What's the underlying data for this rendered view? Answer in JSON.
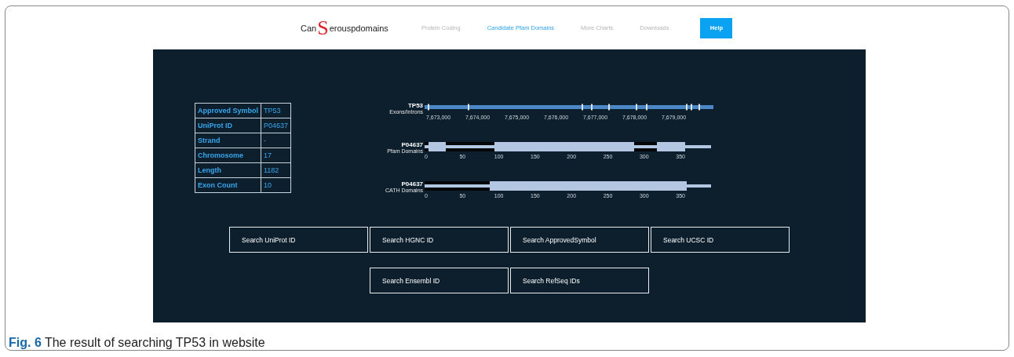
{
  "logo": {
    "before": "Can",
    "big": "S",
    "after": "erouspdomains"
  },
  "nav": [
    {
      "label": "Protein Coding",
      "selected": false
    },
    {
      "label": "Candidate Pfam Domains",
      "selected": true
    },
    {
      "label": "More Charts",
      "selected": false
    },
    {
      "label": "Downloads",
      "selected": false
    }
  ],
  "help_button": "Help",
  "gene_table": [
    {
      "label": "Approved Symbol",
      "value": "TP53"
    },
    {
      "label": "UniProt ID",
      "value": "P04637"
    },
    {
      "label": "Strand",
      "value": "-"
    },
    {
      "label": "Chromosome",
      "value": "17"
    },
    {
      "label": "Length",
      "value": "1182"
    },
    {
      "label": "Exon Count",
      "value": "10"
    }
  ],
  "tracks": [
    {
      "kind": "exons",
      "title": "TP53",
      "subtitle": "Exons/Introns",
      "ticks": [
        "7,673,000",
        "7,674,000",
        "7,675,000",
        "7,676,000",
        "7,677,000",
        "7,678,000",
        "7,679,000"
      ]
    },
    {
      "kind": "pfam",
      "title": "P04637",
      "subtitle": "Pfam Domains",
      "ticks": [
        "0",
        "50",
        "100",
        "150",
        "200",
        "250",
        "300",
        "350"
      ]
    },
    {
      "kind": "cath",
      "title": "P04637",
      "subtitle": "CATH Domains",
      "ticks": [
        "0",
        "50",
        "100",
        "150",
        "200",
        "250",
        "300",
        "350"
      ]
    }
  ],
  "search_buttons": [
    [
      "Search UniProt ID",
      "Search HGNC ID",
      "Search ApprovedSymbol",
      "Search UCSC ID"
    ],
    [
      "Search Ensembl ID",
      "Search RefSeq IDs"
    ]
  ],
  "caption": {
    "label": "Fig. 6",
    "text": "The result of searching TP53 in website"
  }
}
